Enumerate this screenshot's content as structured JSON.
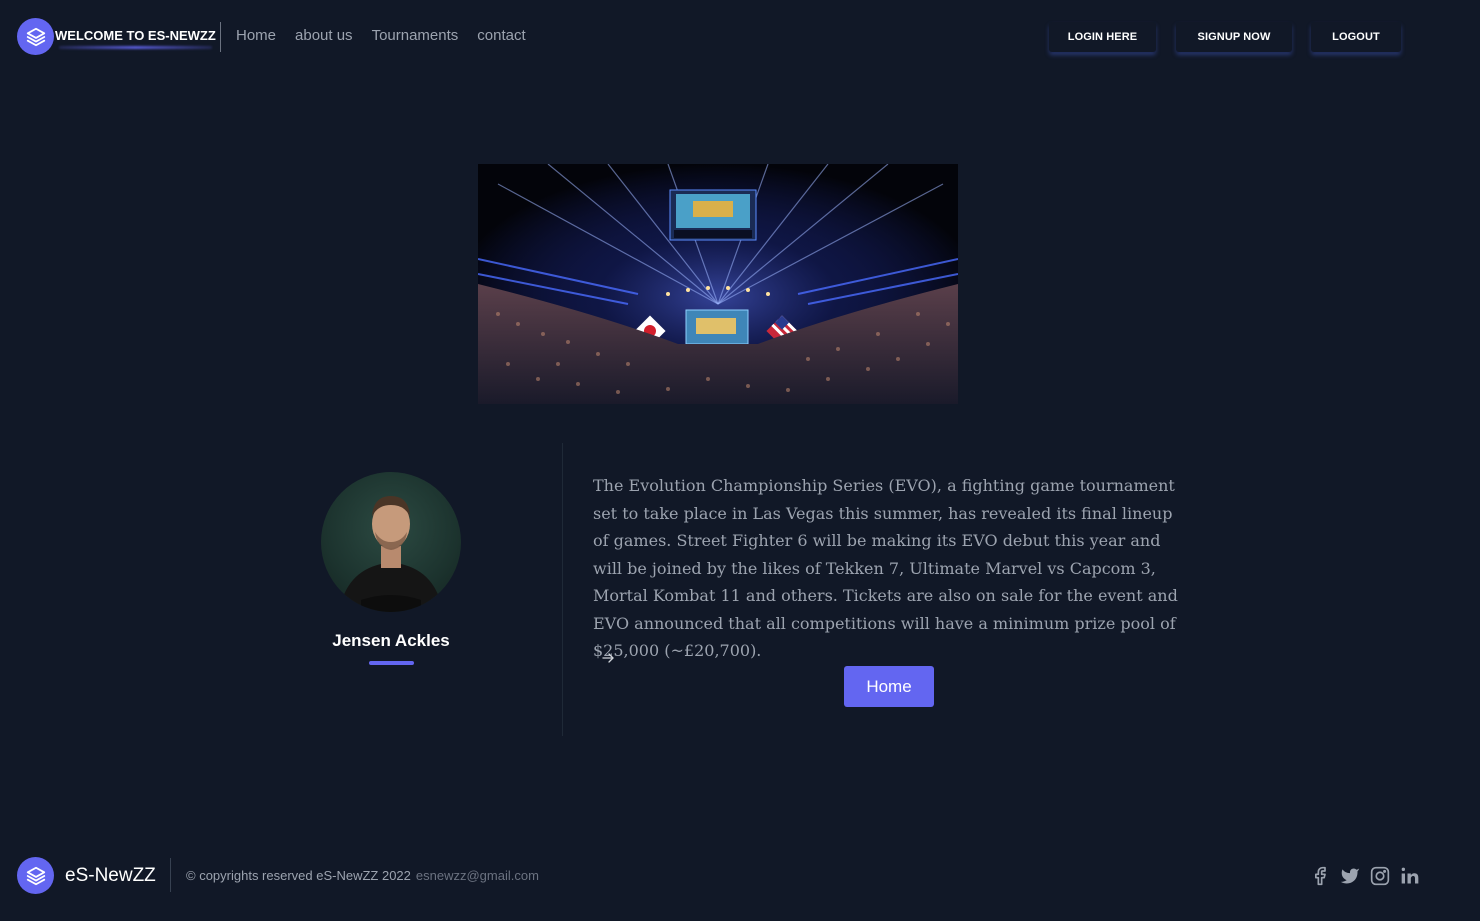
{
  "header": {
    "brand_title": "WELCOME TO ES-NEWZZ",
    "nav": [
      {
        "label": "Home"
      },
      {
        "label": "about us"
      },
      {
        "label": "Tournaments"
      },
      {
        "label": "contact"
      }
    ],
    "auth": {
      "login_label": "LOGIN HERE",
      "signup_label": "SIGNUP NOW",
      "logout_label": "LOGOUT"
    }
  },
  "author": {
    "name": "Jensen Ackles"
  },
  "article": {
    "body": "The Evolution Championship Series (EVO), a fighting game tournament set to take place in Las Vegas this summer, has revealed its final lineup of games. Street Fighter 6 will be making its EVO debut this year and will be joined by the likes of Tekken 7, Ultimate Marvel vs Capcom 3, Mortal Kombat 11 and others. Tickets are also on sale for the event and EVO announced that all competitions will have a minimum prize pool of $25,000 (~£20,700).",
    "home_button_label": "Home"
  },
  "footer": {
    "brand": "eS-NewZZ",
    "copyright": "© copyrights reserved eS-NewZZ 2022",
    "email": "esnewzz@gmail.com",
    "social_icons": [
      "facebook-icon",
      "twitter-icon",
      "instagram-icon",
      "linkedin-icon"
    ]
  },
  "colors": {
    "background": "#111827",
    "accent": "#6366f1",
    "text_muted": "#9ca3af",
    "text_white": "#ffffff"
  }
}
